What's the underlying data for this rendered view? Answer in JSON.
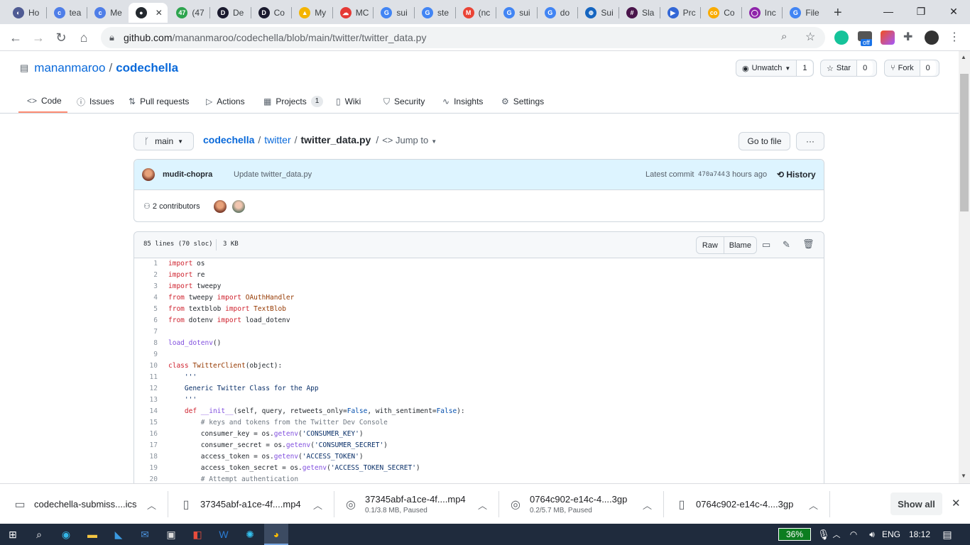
{
  "browser": {
    "tabs": [
      {
        "label": "Ho",
        "color": "#4f5b93",
        "glyph": "◐"
      },
      {
        "label": "tea",
        "color": "#4f7ee8",
        "glyph": "c"
      },
      {
        "label": "Me",
        "color": "#4f7ee8",
        "glyph": "c"
      },
      {
        "label": "",
        "color": "#24292f",
        "glyph": "●"
      },
      {
        "label": "(47",
        "color": "#2da44e",
        "glyph": "47"
      },
      {
        "label": "De",
        "color": "#1a1a2e",
        "glyph": "D"
      },
      {
        "label": "Co",
        "color": "#1a1a2e",
        "glyph": "D"
      },
      {
        "label": "My",
        "color": "#f4b400",
        "glyph": "▲"
      },
      {
        "label": "MC",
        "color": "#e53935",
        "glyph": "☁"
      },
      {
        "label": "sui",
        "color": "#4285f4",
        "glyph": "G"
      },
      {
        "label": "ste",
        "color": "#4285f4",
        "glyph": "G"
      },
      {
        "label": "(nc",
        "color": "#ea4335",
        "glyph": "M"
      },
      {
        "label": "sui",
        "color": "#4285f4",
        "glyph": "G"
      },
      {
        "label": "do",
        "color": "#4285f4",
        "glyph": "G"
      },
      {
        "label": "Sui",
        "color": "#1565c0",
        "glyph": "⊕"
      },
      {
        "label": "Sla",
        "color": "#4a154b",
        "glyph": "#"
      },
      {
        "label": "Prc",
        "color": "#3367d6",
        "glyph": "▶"
      },
      {
        "label": "Co",
        "color": "#f9ab00",
        "glyph": "co"
      },
      {
        "label": "Inc",
        "color": "#8e24aa",
        "glyph": "◯"
      },
      {
        "label": "File",
        "color": "#4285f4",
        "glyph": "G"
      }
    ],
    "new_tab": "+",
    "url_host": "github.com",
    "url_path": "/mananmaroo/codechella/blob/main/twitter/twitter_data.py",
    "ext_off_badge": "off"
  },
  "repo": {
    "owner": "mananmaroo",
    "name": "codechella",
    "unwatch_label": "Unwatch",
    "watch_count": "1",
    "star_label": "Star",
    "star_count": "0",
    "fork_label": "Fork",
    "fork_count": "0",
    "tabs": [
      {
        "label": "Code",
        "icon": "<>"
      },
      {
        "label": "Issues",
        "icon": "ⓘ"
      },
      {
        "label": "Pull requests",
        "icon": "⇅"
      },
      {
        "label": "Actions",
        "icon": "▷"
      },
      {
        "label": "Projects",
        "icon": "▦",
        "count": "1"
      },
      {
        "label": "Wiki",
        "icon": "▯"
      },
      {
        "label": "Security",
        "icon": "⛉"
      },
      {
        "label": "Insights",
        "icon": "∿"
      },
      {
        "label": "Settings",
        "icon": "⚙"
      }
    ]
  },
  "file": {
    "branch": "main",
    "crumb_repo": "codechella",
    "crumb_dir": "twitter",
    "crumb_file": "twitter_data.py",
    "jump_to": "Jump to",
    "go_to_file": "Go to file",
    "more": "···",
    "commit_author": "mudit-chopra",
    "commit_message": "Update twitter_data.py",
    "latest_commit_label": "Latest commit",
    "commit_sha": "470a744",
    "commit_time": "3 hours ago",
    "history_label": "History",
    "contributors_label": "2 contributors",
    "lines_info": "85 lines (70 sloc)",
    "size_info": "3 KB",
    "raw_label": "Raw",
    "blame_label": "Blame"
  },
  "code_lines": [
    {
      "n": "1",
      "html": "<span class='k'>import</span> os"
    },
    {
      "n": "2",
      "html": "<span class='k'>import</span> re"
    },
    {
      "n": "3",
      "html": "<span class='k'>import</span> tweepy"
    },
    {
      "n": "4",
      "html": "<span class='k'>from</span> tweepy <span class='k'>import</span> <span class='t'>OAuthHandler</span>"
    },
    {
      "n": "5",
      "html": "<span class='k'>from</span> textblob <span class='k'>import</span> <span class='t'>TextBlob</span>"
    },
    {
      "n": "6",
      "html": "<span class='k'>from</span> dotenv <span class='k'>import</span> load_dotenv"
    },
    {
      "n": "7",
      "html": ""
    },
    {
      "n": "8",
      "html": "<span class='f'>load_dotenv</span>()"
    },
    {
      "n": "9",
      "html": ""
    },
    {
      "n": "10",
      "html": "<span class='k'>class</span> <span class='t'>TwitterClient</span>(object):"
    },
    {
      "n": "11",
      "html": "    <span class='s'>'''</span>"
    },
    {
      "n": "12",
      "html": "<span class='s'>    Generic Twitter Class for the App</span>"
    },
    {
      "n": "13",
      "html": "    <span class='s'>'''</span>"
    },
    {
      "n": "14",
      "html": "    <span class='k'>def</span> <span class='f'>__init__</span>(self, query, retweets_only=<span class='b'>False</span>, with_sentiment=<span class='b'>False</span>):"
    },
    {
      "n": "15",
      "html": "        <span class='c'># keys and tokens from the Twitter Dev Console</span>"
    },
    {
      "n": "16",
      "html": "        consumer_key = os.<span class='f'>getenv</span>(<span class='s'>'CONSUMER_KEY'</span>)"
    },
    {
      "n": "17",
      "html": "        consumer_secret = os.<span class='f'>getenv</span>(<span class='s'>'CONSUMER_SECRET'</span>)"
    },
    {
      "n": "18",
      "html": "        access_token = os.<span class='f'>getenv</span>(<span class='s'>'ACCESS_TOKEN'</span>)"
    },
    {
      "n": "19",
      "html": "        access_token_secret = os.<span class='f'>getenv</span>(<span class='s'>'ACCESS_TOKEN_SECRET'</span>)"
    },
    {
      "n": "20",
      "html": "        <span class='c'># Attempt authentication</span>"
    }
  ],
  "downloads": [
    {
      "name": "codechella-submiss....ics",
      "status": ""
    },
    {
      "name": "37345abf-a1ce-4f....mp4",
      "status": ""
    },
    {
      "name": "37345abf-a1ce-4f....mp4",
      "status": "0.1/3.8 MB, Paused"
    },
    {
      "name": "0764c902-e14c-4....3gp",
      "status": "0.2/5.7 MB, Paused"
    },
    {
      "name": "0764c902-e14c-4....3gp",
      "status": ""
    }
  ],
  "show_all_label": "Show all",
  "taskbar": {
    "battery": "36%",
    "lang": "ENG",
    "time": "18:12"
  }
}
